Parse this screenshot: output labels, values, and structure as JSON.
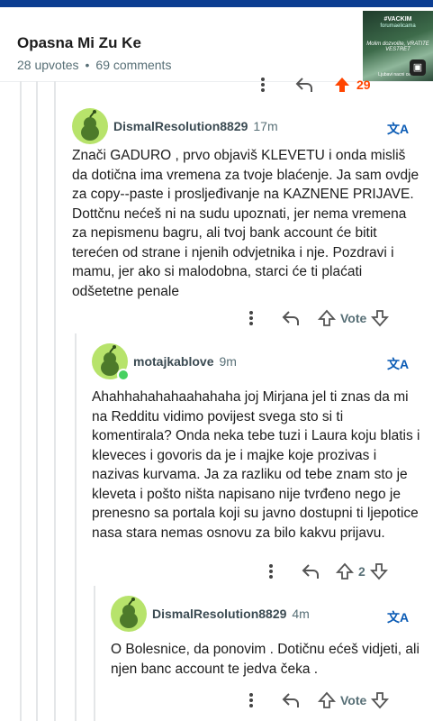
{
  "post": {
    "title": "Opasna Mi Zu Ke",
    "upvotes": "28 upvotes",
    "comments": "69 comments",
    "thumbnail": {
      "top_text": "#VACKIM",
      "sub_text": "forumaelicama",
      "mid_text": "Molim dozvolite, VRATITE VESTRET",
      "bottom_text": "Ljubavi nacni ce biti"
    }
  },
  "prev_actions": {
    "upvote_count": "29"
  },
  "comments": [
    {
      "username": "DismalResolution8829",
      "time": "17m",
      "text": "Znači GADURO , prvo objaviš KLEVETU i onda misliš da dotična ima vremena za tvoje blaćenje. Ja sam ovdje za copy--paste i prosljeđivanje na KAZNENE PRIJAVE. Dottčnu nećeš ni na sudu upoznati, jer nema vremena za nepismenu bagru, ali tvoj bank account će bitit terećen od strane i njenih odvjetnika i nje. Pozdravi i mamu, jer ako si malodobna, starci će ti plaćati odšetetne penale",
      "vote_label": "Vote"
    },
    {
      "username": "motajkablove",
      "time": "9m",
      "text": "Ahahhahahahaahahaha joj Mirjana jel ti znas da mi na Redditu vidimo povijest svega sto si ti komentirala? Onda neka tebe tuzi i Laura koju blatis i kleveces i govoris da je i majke koje prozivas i nazivas kurvama. Ja za razliku od tebe znam sto je kleveta i pošto ništa napisano nije tvrđeno nego je prenesno sa portala koji su javno dostupni ti ljepotice nasa stara nemas osnovu za bilo kakvu prijavu.",
      "vote_label": "2"
    },
    {
      "username": "DismalResolution8829",
      "time": "4m",
      "text": "O Bolesnice, da ponovim . Dotičnu ećeš vidjeti, ali njen banc account te jedva čeka .",
      "vote_label": "Vote"
    }
  ],
  "translate_label": "文A",
  "colors": {
    "accent": "#0a5bb5",
    "avatar_bg": "#b7e36b",
    "online": "#46d160",
    "upvote_orange": "#ff4500"
  }
}
